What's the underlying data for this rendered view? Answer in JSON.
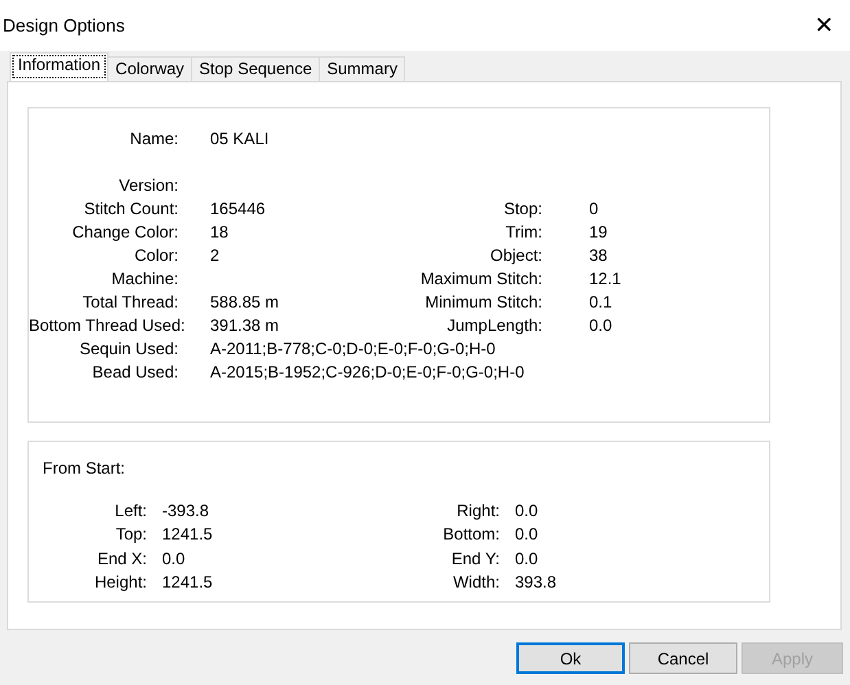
{
  "window": {
    "title": "Design Options",
    "close": "✕"
  },
  "tabs": [
    {
      "label": "Information",
      "selected": true
    },
    {
      "label": "Colorway",
      "selected": false
    },
    {
      "label": "Stop Sequence",
      "selected": false
    },
    {
      "label": "Summary",
      "selected": false
    }
  ],
  "information": {
    "left": [
      {
        "label": "Name:",
        "value": "05 KALI"
      },
      {
        "label": "Version:"
      },
      {
        "label": "Stitch Count:",
        "value": "165446"
      },
      {
        "label": "Change Color:",
        "value": "18"
      },
      {
        "label": "Color:",
        "value": "2"
      },
      {
        "label": "Machine:"
      },
      {
        "label": "Total Thread:",
        "value": "588.85 m"
      },
      {
        "label": "Bottom Thread Used:",
        "value": "391.38 m"
      },
      {
        "label": "Sequin Used:",
        "value": "A-2011;B-778;C-0;D-0;E-0;F-0;G-0;H-0"
      },
      {
        "label": "Bead Used:",
        "value": "A-2015;B-1952;C-926;D-0;E-0;F-0;G-0;H-0"
      }
    ],
    "right": [
      {
        "label": "Stop:",
        "value": "0"
      },
      {
        "label": "Trim:",
        "value": "19"
      },
      {
        "label": "Object:",
        "value": "38"
      },
      {
        "label": "Maximum Stitch:",
        "value": "12.1"
      },
      {
        "label": "Minimum Stitch:",
        "value": "0.1"
      },
      {
        "label": "JumpLength:",
        "value": "0.0"
      }
    ]
  },
  "from_start": {
    "title": "From Start:",
    "left": [
      {
        "label": "Left:",
        "value": "-393.8"
      },
      {
        "label": "Top:",
        "value": "1241.5"
      },
      {
        "label": "End X:",
        "value": "0.0"
      },
      {
        "label": "Height:",
        "value": "1241.5"
      }
    ],
    "right": [
      {
        "label": "Right:",
        "value": "0.0"
      },
      {
        "label": "Bottom:",
        "value": "0.0"
      },
      {
        "label": "End Y:",
        "value": "0.0"
      },
      {
        "label": "Width:",
        "value": "393.8"
      }
    ]
  },
  "buttons": [
    {
      "label": "Ok",
      "default": true,
      "disabled": false
    },
    {
      "label": "Cancel",
      "default": false,
      "disabled": false
    },
    {
      "label": "Apply",
      "default": false,
      "disabled": true
    }
  ]
}
